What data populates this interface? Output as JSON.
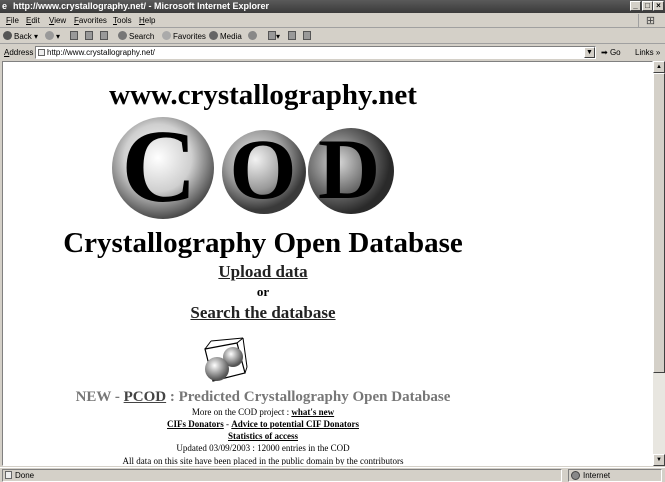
{
  "window": {
    "title": "http://www.crystallography.net/ - Microsoft Internet Explorer"
  },
  "menu": {
    "items": [
      "File",
      "Edit",
      "View",
      "Favorites",
      "Tools",
      "Help"
    ]
  },
  "toolbar": {
    "back_label": "Back",
    "search_label": "Search",
    "favorites_label": "Favorites",
    "media_label": "Media"
  },
  "address": {
    "label": "Address",
    "url": "http://www.crystallography.net/",
    "go_label": "Go",
    "links_label": "Links"
  },
  "page": {
    "site_url": "www.crystallography.net",
    "logo_letters": [
      "C",
      "O",
      "D"
    ],
    "db_name": "Crystallography Open Database",
    "upload_link": "Upload data",
    "or_text": "or",
    "search_link": "Search the database",
    "pcod_prefix": "NEW - ",
    "pcod_link": "PCOD",
    "pcod_suffix": " : Predicted Crystallography Open Database",
    "more_text": "More on the COD project : ",
    "whats_new_link": "what's new",
    "cifs_donators_link": "CIFs Donators",
    "dash": " - ",
    "advice_link": "Advice to potential CIF Donators",
    "stats_link": "Statistics of access",
    "updated_text": "Updated 03/09/2003 : 12000 entries in the COD",
    "public_text": "All data on this site have been placed in the public domain by the contributors"
  },
  "status": {
    "left_text": "Done",
    "zone_text": "Internet"
  }
}
